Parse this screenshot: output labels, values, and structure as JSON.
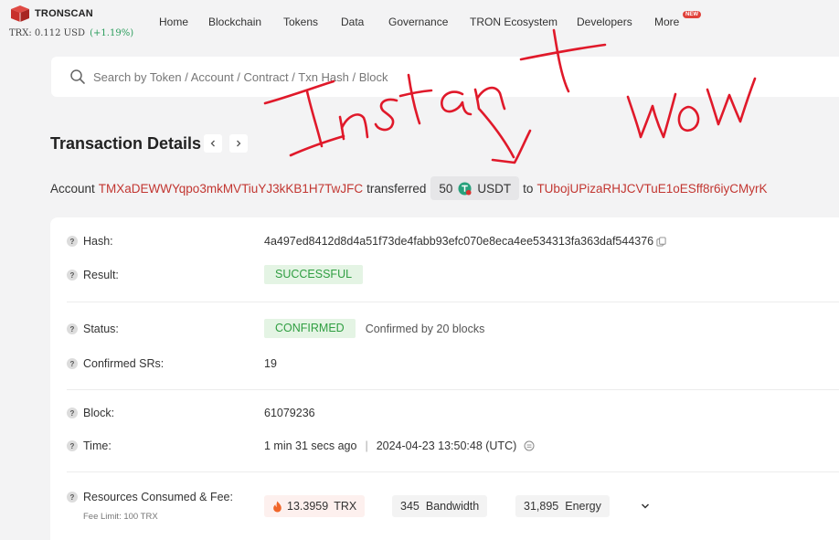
{
  "brand": {
    "name": "TRONSCAN"
  },
  "price": {
    "label": "TRX: 0.112 USD",
    "change": "(+1.19%)"
  },
  "nav": {
    "home": "Home",
    "blockchain": "Blockchain",
    "tokens": "Tokens",
    "data": "Data",
    "governance": "Governance",
    "ecosystem": "TRON Ecosystem",
    "developers": "Developers",
    "more": "More",
    "new_badge": "NEW"
  },
  "search": {
    "placeholder": "Search by Token / Account / Contract / Txn Hash / Block"
  },
  "page": {
    "title": "Transaction Details"
  },
  "summary": {
    "account_word": "Account",
    "from": "TMXaDEWWYqpo3mkMVTiuYJ3kKB1H7TwJFC",
    "transferred_word": "transferred",
    "amount": "50",
    "token": "USDT",
    "to_word": "to",
    "to": "TUbojUPizaRHJCVTuE1oESff8r6iyCMyrK"
  },
  "details": {
    "hash_label": "Hash:",
    "hash": "4a497ed8412d8d4a51f73de4fabb93efc070e8eca4ee534313fa363daf544376",
    "result_label": "Result:",
    "result": "SUCCESSFUL",
    "status_label": "Status:",
    "status": "CONFIRMED",
    "confirmed_by": "Confirmed by 20 blocks",
    "srs_label": "Confirmed SRs:",
    "srs": "19",
    "block_label": "Block:",
    "block": "61079236",
    "time_label": "Time:",
    "time_ago": "1 min 31 secs ago",
    "time_full": "2024-04-23 13:50:48 (UTC)",
    "resources_label": "Resources Consumed & Fee:",
    "fee_limit": "Fee Limit: 100 TRX",
    "fee_amount": "13.3959",
    "fee_unit": "TRX",
    "bandwidth_amount": "345",
    "bandwidth_unit": "Bandwidth",
    "energy_amount": "31,895",
    "energy_unit": "Energy"
  },
  "annotations": {
    "word1": "Instant",
    "word2": "WoW"
  },
  "colors": {
    "address": "#c23631",
    "success_bg": "#e4f4e4",
    "success_text": "#2f9e41",
    "scribble": "#e0192a",
    "brand_red": "#c8302c"
  },
  "icons": [
    "tronscan-logo-icon",
    "search-icon",
    "chevron-left-icon",
    "chevron-right-icon",
    "usdt-token-icon",
    "help-icon",
    "copy-icon",
    "timezone-icon",
    "flame-icon",
    "chevron-down-icon"
  ]
}
